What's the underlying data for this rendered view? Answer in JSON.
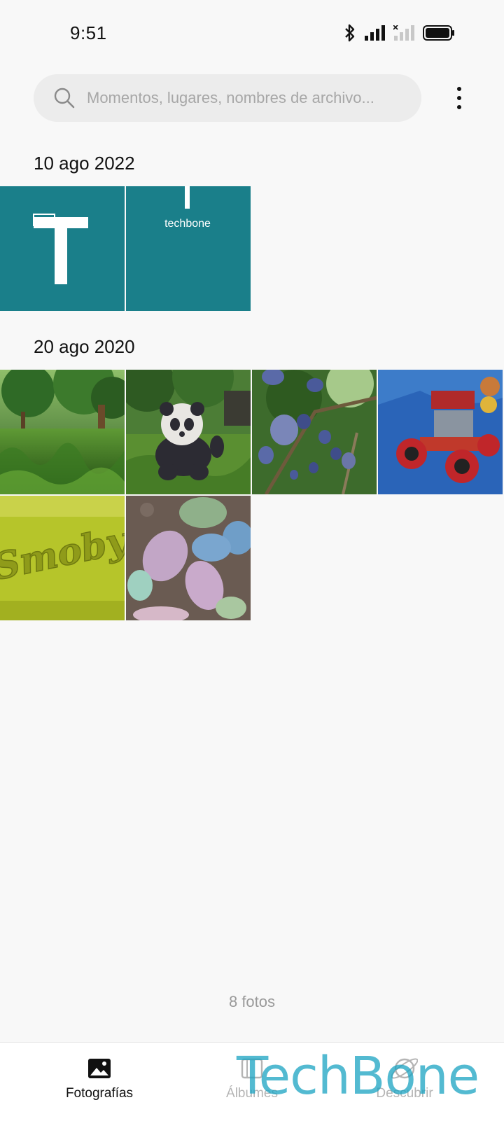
{
  "status_bar": {
    "time": "9:51",
    "icons": [
      "bluetooth-icon",
      "signal-icon",
      "signal-off-icon",
      "battery-icon"
    ]
  },
  "search": {
    "placeholder": "Momentos, lugares, nombres de archivo..."
  },
  "sections": [
    {
      "date": "10 ago 2022",
      "photos": [
        {
          "name": "techbone-logo-t"
        },
        {
          "name": "techbone-logo-text",
          "caption": "techbone"
        }
      ]
    },
    {
      "date": "20 ago 2020",
      "photos": [
        {
          "name": "grass-trees"
        },
        {
          "name": "panda-plush"
        },
        {
          "name": "plum-tree"
        },
        {
          "name": "toy-car"
        },
        {
          "name": "smoby-toy",
          "caption": "Smoby"
        },
        {
          "name": "chalk-pieces"
        }
      ]
    }
  ],
  "photo_count": "8 fotos",
  "bottom_nav": {
    "items": [
      {
        "label": "Fotografías",
        "icon": "photo-icon",
        "active": true
      },
      {
        "label": "Álbumes",
        "icon": "album-icon",
        "active": false
      },
      {
        "label": "Descubrir",
        "icon": "discover-icon",
        "active": false
      }
    ]
  },
  "watermark": "TechBone",
  "colors": {
    "background": "#f8f8f8",
    "teal_tile": "#1a7f8a",
    "watermark": "#1aa3c2"
  }
}
